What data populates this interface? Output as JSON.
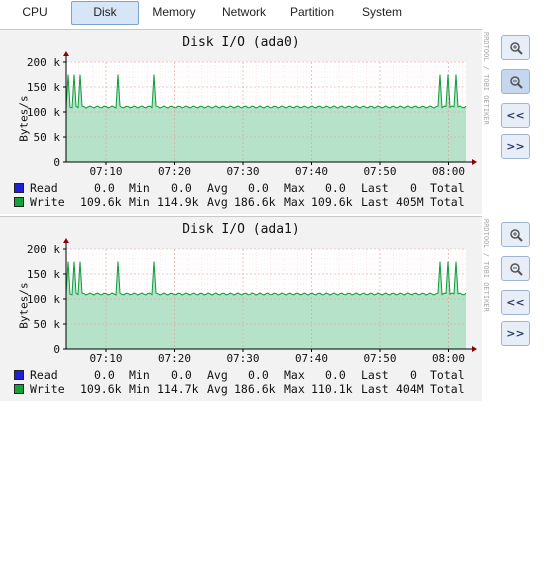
{
  "tabs": [
    {
      "label": "CPU"
    },
    {
      "label": "Disk",
      "active": true
    },
    {
      "label": "Memory"
    },
    {
      "label": "Network"
    },
    {
      "label": "Partition"
    },
    {
      "label": "System"
    }
  ],
  "colors": {
    "read": "#1f1fd6",
    "write": "#15a23a",
    "area": "#b5e2c8",
    "line": "#0b9d3a",
    "grid": "#e79a9a",
    "axis": "#8b0000"
  },
  "side_text": "RRDTOOL / TOBI OETIKER",
  "y_label": "Bytes/s",
  "y_ticks": [
    "200 k",
    "150 k",
    "100 k",
    "50 k",
    "0"
  ],
  "x_ticks": [
    "07:10",
    "07:20",
    "07:30",
    "07:40",
    "07:50",
    "08:00"
  ],
  "legend_headers": {
    "min": "Min",
    "avg": "Avg",
    "max": "Max",
    "last": "Last",
    "total": "Total"
  },
  "buttons": {
    "zoom_in_icon": "zoom-in-magnifier",
    "zoom_out_icon": "zoom-out-magnifier",
    "back_label": "<<",
    "forward_label": ">>"
  },
  "graphs": [
    {
      "title": "Disk I/O (ada0)",
      "read": {
        "name": "Read",
        "cur": "0.0",
        "min": "0.0",
        "avg": "0.0",
        "max": "0.0",
        "last": "0"
      },
      "write": {
        "name": "Write",
        "cur": "109.6k",
        "min": "114.9k",
        "avg": "186.6k",
        "max": "109.6k",
        "last": "405M"
      }
    },
    {
      "title": "Disk I/O (ada1)",
      "read": {
        "name": "Read",
        "cur": "0.0",
        "min": "0.0",
        "avg": "0.0",
        "max": "0.0",
        "last": "0"
      },
      "write": {
        "name": "Write",
        "cur": "109.6k",
        "min": "114.7k",
        "avg": "186.6k",
        "max": "110.1k",
        "last": "404M"
      }
    }
  ],
  "chart_data": [
    {
      "type": "area",
      "title": "Disk I/O (ada0)",
      "ylabel": "Bytes/s",
      "ylim": [
        0,
        200000
      ],
      "x_ticks": [
        "07:10",
        "07:20",
        "07:30",
        "07:40",
        "07:50",
        "08:00"
      ],
      "series": [
        {
          "name": "Read",
          "values": [
            0,
            0,
            0,
            0,
            0,
            0
          ]
        },
        {
          "name": "Write",
          "baseline": 110000,
          "spikes": [
            175000,
            175000,
            175000,
            175000,
            175000,
            175000,
            175000,
            175000
          ]
        }
      ]
    },
    {
      "type": "area",
      "title": "Disk I/O (ada1)",
      "ylabel": "Bytes/s",
      "ylim": [
        0,
        200000
      ],
      "x_ticks": [
        "07:10",
        "07:20",
        "07:30",
        "07:40",
        "07:50",
        "08:00"
      ],
      "series": [
        {
          "name": "Read",
          "values": [
            0,
            0,
            0,
            0,
            0,
            0
          ]
        },
        {
          "name": "Write",
          "baseline": 110000,
          "spikes": [
            175000,
            175000,
            175000,
            175000,
            175000,
            175000,
            175000,
            175000
          ]
        }
      ]
    }
  ]
}
